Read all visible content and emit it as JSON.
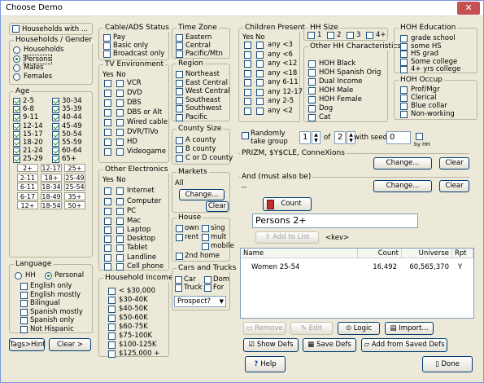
{
  "title": "Choose Demo",
  "top_checkbox": "Households with ...",
  "hh_gender": {
    "title": "Households / Gender",
    "options": [
      "Households",
      "Persons",
      "Males",
      "Females"
    ]
  },
  "age": {
    "title": "Age",
    "left": [
      "2-5",
      "6-8",
      "9-11",
      "12-14",
      "15-17",
      "18-20",
      "21-24",
      "25-29"
    ],
    "right": [
      "30-34",
      "35-39",
      "40-44",
      "45-49",
      "50-54",
      "55-59",
      "60-64",
      "65+"
    ],
    "buttons": [
      [
        "2+",
        "12-17",
        "25+"
      ],
      [
        "2-11",
        "18+",
        "25-49"
      ],
      [
        "6-11",
        "18-34",
        "25-54"
      ],
      [
        "6-17",
        "18-49",
        "35+"
      ],
      [
        "12+",
        "18-54",
        "50+"
      ]
    ]
  },
  "language": {
    "title": "Language",
    "options": [
      "HH",
      "Personal"
    ],
    "items": [
      "English only",
      "English mostly",
      "Bilingual",
      "Spanish mostly",
      "Spanish only",
      "Not Hispanic"
    ]
  },
  "tags_btn": "Tags>Hint",
  "clear_left": "Clear >",
  "cable": {
    "title": "Cable/ADS Status",
    "items": [
      "Pay",
      "Basic only",
      "Broadcast only"
    ]
  },
  "tv_env": {
    "title": "TV Environment",
    "yes": "Yes",
    "no": "No",
    "items": [
      "VCR",
      "DVD",
      "DBS",
      "DBS or Alt",
      "Wired cable",
      "DVR/TiVo",
      "HD",
      "Videogame"
    ]
  },
  "elec": {
    "title": "Other Electronics",
    "yes": "Yes",
    "no": "No",
    "items": [
      "Internet",
      "Computer",
      "PC",
      "Mac",
      "Laptop",
      "Desktop",
      "Tablet",
      "Landline",
      "Cell phone"
    ]
  },
  "income": {
    "title": "Household Income",
    "items": [
      "< $30,000",
      "$30-40K",
      "$40-50K",
      "$50-60K",
      "$60-75K",
      "$75-100K",
      "$100-125K",
      "$125,000 +"
    ]
  },
  "tz": {
    "title": "Time Zone",
    "items": [
      "Eastern",
      "Central",
      "Pacific/Mtn"
    ]
  },
  "region": {
    "title": "Region",
    "items": [
      "Northeast",
      "East Central",
      "West Central",
      "Southeast",
      "Southwest",
      "Pacific"
    ]
  },
  "county": {
    "title": "County Size",
    "items": [
      "A county",
      "B county",
      "C or D county"
    ]
  },
  "markets": {
    "title": "Markets",
    "value": "All",
    "change": "Change...",
    "clear": "Clear"
  },
  "house": {
    "title": "House",
    "items": [
      "own",
      "sing",
      "rent",
      "mult",
      "mobile",
      "2nd home"
    ]
  },
  "cars": {
    "title": "Cars and Trucks",
    "items": [
      "Car",
      "Dom",
      "Truck",
      "For"
    ],
    "select": "Prospect?"
  },
  "children": {
    "title": "Children Present",
    "yes": "Yes",
    "no": "No",
    "items": [
      "any <3",
      "any <6",
      "any <12",
      "any <18",
      "any 6-11",
      "any 12-17",
      "any 2-5",
      "any <2"
    ]
  },
  "hh_size": {
    "title": "HH Size",
    "items": [
      "1",
      "2",
      "3",
      "4+"
    ]
  },
  "other_hh": {
    "title": "Other HH Characteristics",
    "items": [
      "HOH Black",
      "HOH Spanish Orig",
      "Dual Income",
      "HOH Male",
      "HOH Female",
      "Dog",
      "Cat"
    ]
  },
  "hoh_edu": {
    "title": "HOH Education",
    "items": [
      "grade school",
      "some HS",
      "HS grad",
      "Some college",
      "4+ yrs college"
    ]
  },
  "hoh_occ": {
    "title": "HOH Occup",
    "items": [
      "Prof/Mgr",
      "Clerical",
      "Blue collar",
      "Non-working"
    ]
  },
  "random": {
    "label": "Randomly take group",
    "n1": "1",
    "of": "of",
    "n2": "2",
    "seed_label": "with seed",
    "seed": "0",
    "by": "by HH"
  },
  "prizm": {
    "title": "PRIZM, $Y$CLE, ConneXions",
    "change": "Change...",
    "clear": "Clear"
  },
  "and": {
    "title": "And (must also be)",
    "value": "--",
    "change": "Change...",
    "clear": "Clear"
  },
  "count_btn": "Count",
  "name_field": "Persons 2+",
  "add_list": "Add to List",
  "kev": "<kev>",
  "table": {
    "headers": [
      "Name",
      "Count",
      "Universe",
      "Rpt"
    ],
    "rows": [
      [
        "Women 25-54",
        "16,492",
        "60,565,370",
        "Y"
      ]
    ]
  },
  "actions": {
    "remove": "Remove",
    "edit": "Edit",
    "logic": "Logic",
    "import": "Import..."
  },
  "defs": {
    "show": "Show Defs",
    "save": "Save Defs",
    "add": "Add from Saved Defs"
  },
  "help": "Help",
  "done": "Done"
}
